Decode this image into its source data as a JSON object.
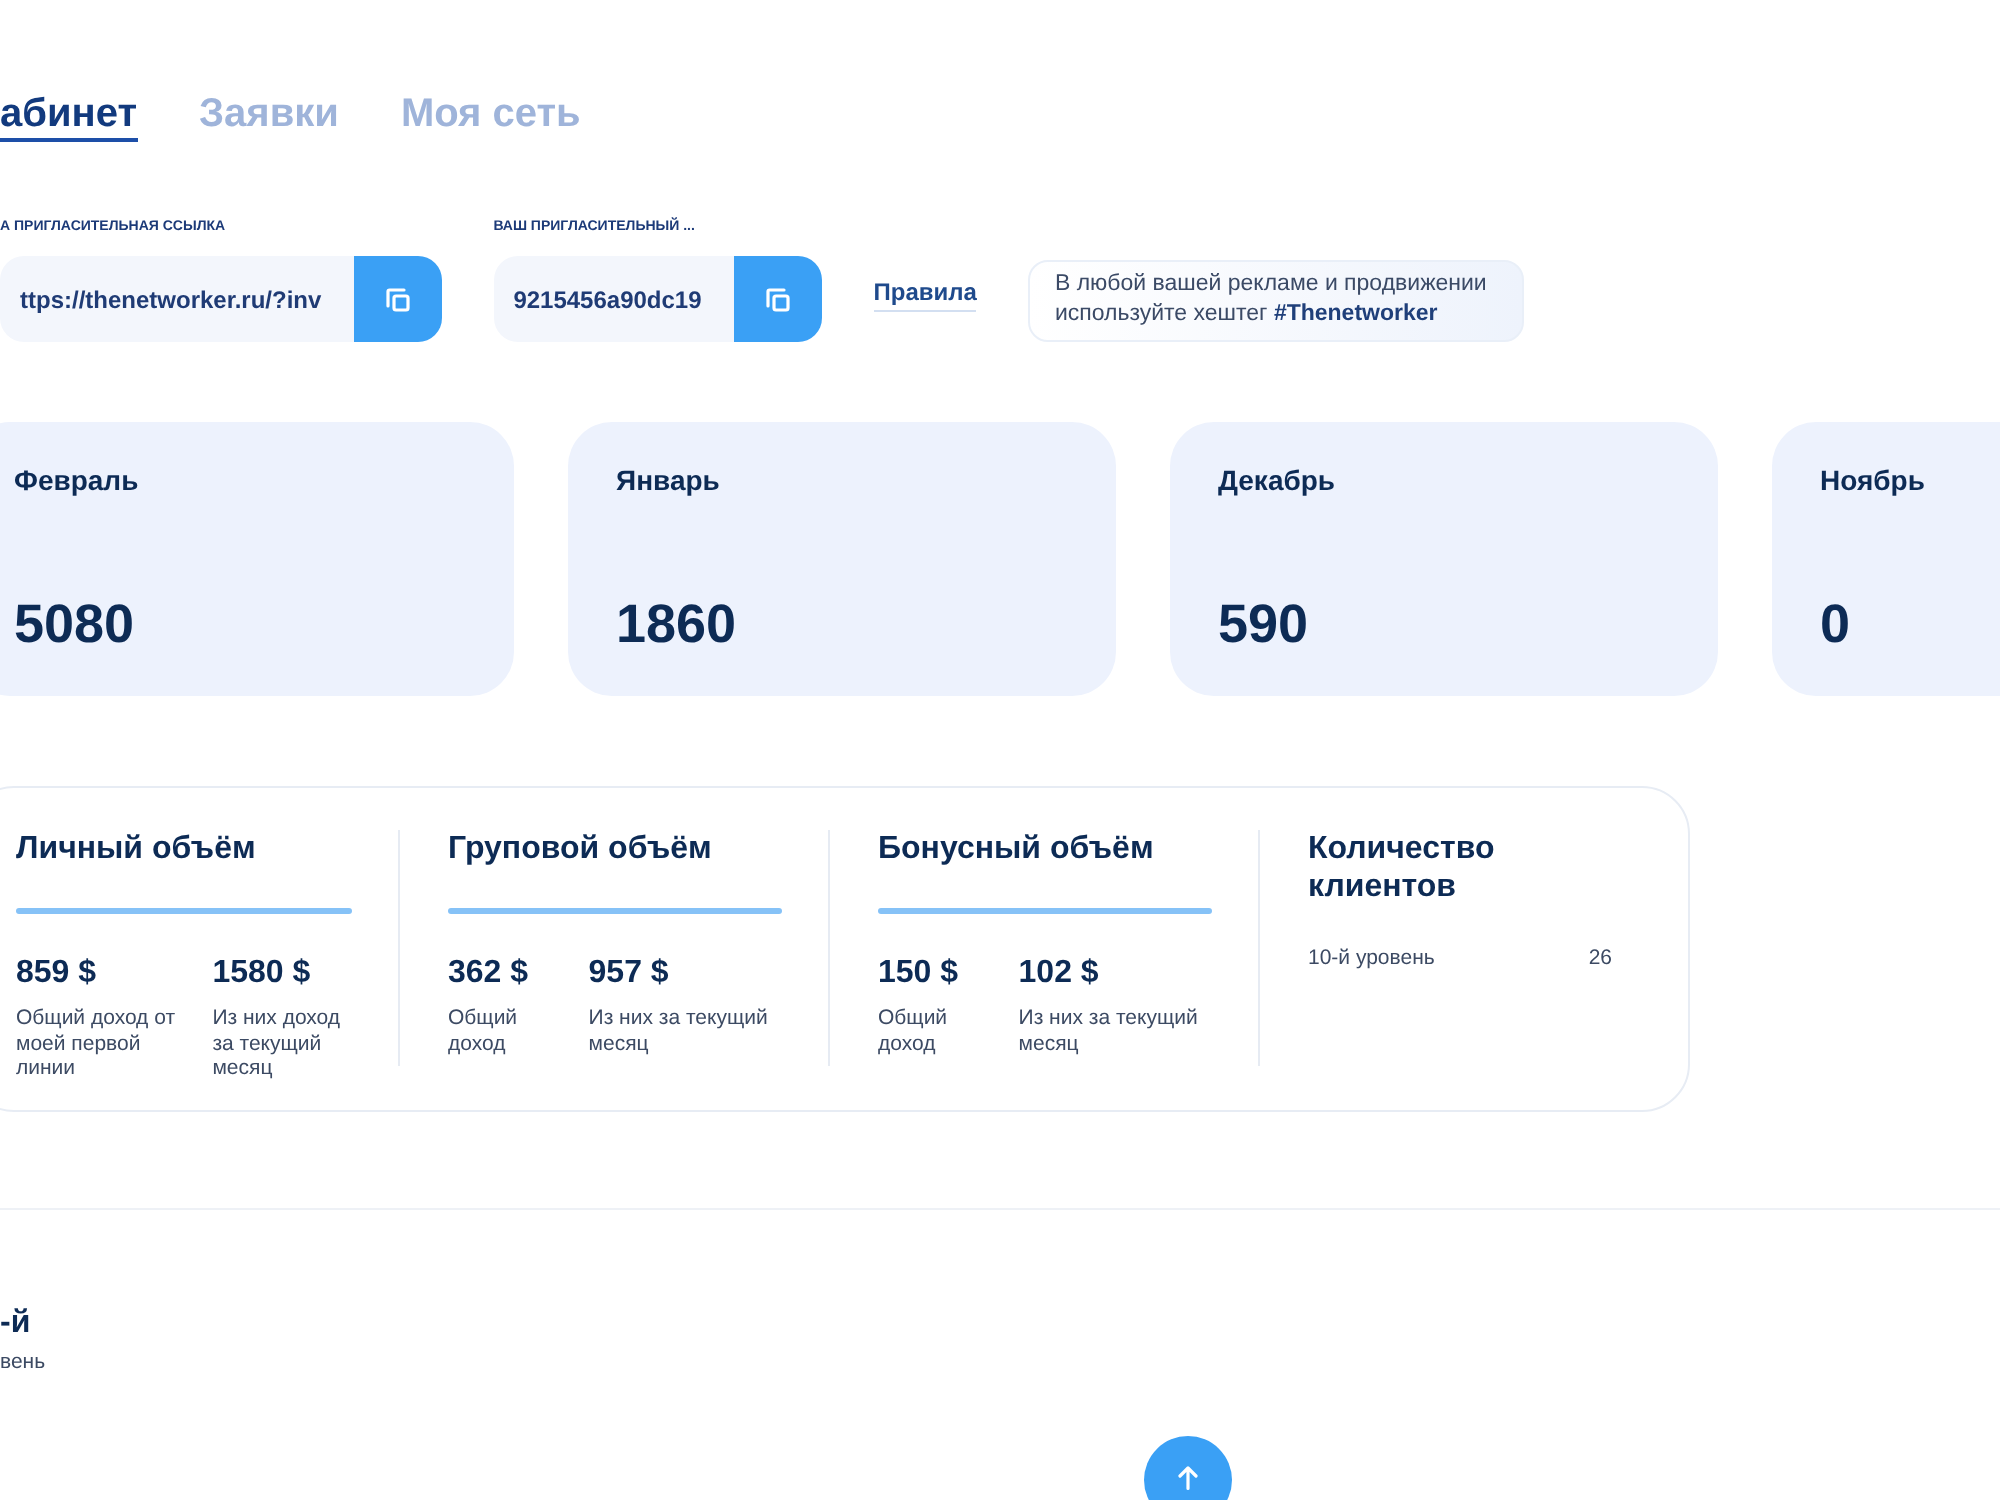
{
  "tabs": [
    {
      "label": "абинет",
      "selected": true
    },
    {
      "label": "Заявки",
      "selected": false
    },
    {
      "label": "Моя сеть",
      "selected": false
    }
  ],
  "invite_fields": [
    {
      "label": "А ПРИГЛАСИТЕЛЬНАЯ ССЫЛКА",
      "value": "ttps://thenetworker.ru/?inv"
    },
    {
      "label": "ВАШ ПРИГЛАСИТЕЛЬНЫЙ ...",
      "value": "9215456a90dc19"
    }
  ],
  "rules_link": "Правила",
  "hint": "В любой вашей рекламе и продвижении используйте хештег **#Thenetworker**",
  "months": [
    {
      "month": "Февраль",
      "value": "5080"
    },
    {
      "month": "Январь",
      "value": "1860"
    },
    {
      "month": "Декабрь",
      "value": "590"
    },
    {
      "month": "Ноябрь",
      "value": "0"
    }
  ],
  "volumes": [
    {
      "title": "Личный объём",
      "stats": [
        {
          "value": "859 $",
          "caption": "Общий доход от моей первой линии"
        },
        {
          "value": "1580 $",
          "caption": "Из них доход за текущий месяц"
        }
      ]
    },
    {
      "title": "Груповой объём",
      "stats": [
        {
          "value": "362 $",
          "caption": "Общий доход"
        },
        {
          "value": "957 $",
          "caption": "Из них за текущий месяц"
        }
      ]
    },
    {
      "title": "Бонусный объём",
      "stats": [
        {
          "value": "150 $",
          "caption": "Общий доход"
        },
        {
          "value": "102 $",
          "caption": "Из них за текущий месяц"
        }
      ]
    }
  ],
  "clients": {
    "title": "Количество клиентов",
    "rows": [
      {
        "label": "10-й уровень",
        "count": "26"
      }
    ]
  },
  "level_section": {
    "title": "-й",
    "caption": "вень"
  }
}
